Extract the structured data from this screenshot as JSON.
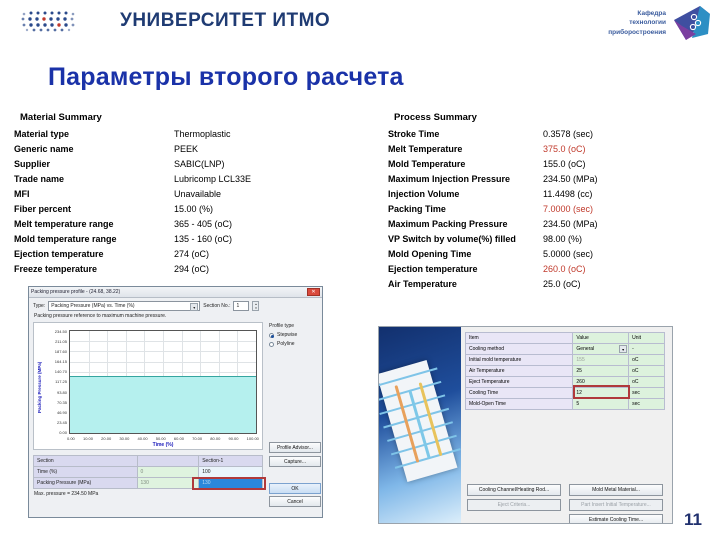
{
  "header": {
    "university": "УНИВЕРСИТЕТ ИТМО",
    "department_line1": "Кафедра",
    "department_line2": "технологии",
    "department_line3": "приборостроения"
  },
  "slide": {
    "title": "Параметры второго расчета",
    "page_number": "11"
  },
  "material_summary": {
    "heading": "Material Summary",
    "rows": [
      {
        "key": "Material type",
        "value": "Thermoplastic",
        "highlight": false
      },
      {
        "key": "Generic name",
        "value": "PEEK",
        "highlight": false
      },
      {
        "key": "Supplier",
        "value": "SABIC(LNP)",
        "highlight": false
      },
      {
        "key": "Trade name",
        "value": "Lubricomp LCL33E",
        "highlight": false
      },
      {
        "key": "MFI",
        "value": "Unavailable",
        "highlight": false
      },
      {
        "key": "Fiber percent",
        "value": "15.00 (%)",
        "highlight": false
      },
      {
        "key": "Melt temperature range",
        "value": "365 - 405 (oC)",
        "highlight": false
      },
      {
        "key": "Mold temperature range",
        "value": "135 - 160 (oC)",
        "highlight": false
      },
      {
        "key": "Ejection temperature",
        "value": "274 (oC)",
        "highlight": false
      },
      {
        "key": "Freeze temperature",
        "value": "294 (oC)",
        "highlight": false
      }
    ]
  },
  "process_summary": {
    "heading": "Process Summary",
    "rows": [
      {
        "key": "Stroke Time",
        "value": "0.3578 (sec)",
        "highlight": false
      },
      {
        "key": "Melt Temperature",
        "value": "375.0 (oC)",
        "highlight": true
      },
      {
        "key": "Mold Temperature",
        "value": "155.0 (oC)",
        "highlight": false
      },
      {
        "key": "Maximum Injection Pressure",
        "value": "234.50 (MPa)",
        "highlight": false
      },
      {
        "key": "Injection Volume",
        "value": "11.4498 (cc)",
        "highlight": false
      },
      {
        "key": "Packing Time",
        "value": "7.0000 (sec)",
        "highlight": true
      },
      {
        "key": "Maximum Packing Pressure",
        "value": "234.50 (MPa)",
        "highlight": false
      },
      {
        "key": "VP Switch by volume(%) filled",
        "value": "98.00 (%)",
        "highlight": false
      },
      {
        "key": "Mold Opening Time",
        "value": "5.0000 (sec)",
        "highlight": false
      },
      {
        "key": "Ejection temperature",
        "value": "260.0 (oC)",
        "highlight": true
      },
      {
        "key": "Air Temperature",
        "value": "25.0 (oC)",
        "highlight": false
      }
    ]
  },
  "packing_window": {
    "title": "Packing pressure profile - (24.68, 38.22)",
    "close_label": "✕",
    "type_label": "Type:",
    "type_value": "Packing Pressure (MPa) vs. Time (%)",
    "section_no_label": "Section No.:",
    "section_no_value": "1",
    "note": "Packing pressure reference to maximum machine pressure.",
    "profile_type_label": "Profile type",
    "profile_options": [
      {
        "label": "Stepwise",
        "selected": true
      },
      {
        "label": "Polyline",
        "selected": false
      }
    ],
    "buttons": {
      "advisor": "Profile Advisor...",
      "capture": "Capture...",
      "ok": "OK",
      "cancel": "Cancel"
    },
    "grid": {
      "header": [
        "Section",
        "",
        "Section-1"
      ],
      "rows": [
        {
          "label": "Time (%)",
          "c2": "0",
          "c3": "100"
        },
        {
          "label": "Packing Pressure (MPa)",
          "c2": "130",
          "c3": "130"
        }
      ]
    },
    "max_pressure": "Max. pressure = 234.50 MPa"
  },
  "chart_data": {
    "type": "area",
    "title": "Packing pressure profile",
    "xlabel": "Time (%)",
    "ylabel": "Packing Pressure (MPa)",
    "xlim": [
      0,
      100
    ],
    "ylim": [
      0,
      234.5
    ],
    "xticks": [
      "0.00",
      "10.00",
      "20.00",
      "30.00",
      "40.00",
      "50.00",
      "60.00",
      "70.00",
      "80.00",
      "90.00",
      "100.00"
    ],
    "yticks": [
      "234.50",
      "211.05",
      "187.60",
      "164.15",
      "140.70",
      "117.25",
      "93.80",
      "70.35",
      "46.90",
      "23.45",
      "0.00"
    ],
    "grid": true,
    "legend": "none",
    "series": [
      {
        "name": "Packing Pressure (MPa)",
        "x": [
          0,
          100
        ],
        "values": [
          130,
          130
        ]
      }
    ]
  },
  "cooling_window": {
    "table": {
      "headers": [
        "Item",
        "Value",
        "Unit"
      ],
      "rows": [
        {
          "item": "Cooling method",
          "value": "General",
          "unit": "-",
          "dropdown": true,
          "gray": false
        },
        {
          "item": "Initial mold temperature",
          "value": "155",
          "unit": "oC",
          "dropdown": false,
          "gray": true
        },
        {
          "item": "Air Temperature",
          "value": "25",
          "unit": "oC",
          "dropdown": false,
          "gray": false
        },
        {
          "item": "Eject Temperature",
          "value": "260",
          "unit": "oC",
          "dropdown": false,
          "gray": false
        },
        {
          "item": "Cooling Time",
          "value": "12",
          "unit": "sec",
          "dropdown": false,
          "gray": false
        },
        {
          "item": "Mold-Open Time",
          "value": "5",
          "unit": "sec",
          "dropdown": false,
          "gray": false
        }
      ]
    },
    "buttons": {
      "cooling_channel": "Cooling Channel/Heating Rod...",
      "mold_metal": "Mold Metal Material...",
      "eject_criteria": "Eject Criteria...",
      "part_insert": "Part Insert Initial Temperature...",
      "estimate": "Estimate Cooling Time..."
    }
  }
}
